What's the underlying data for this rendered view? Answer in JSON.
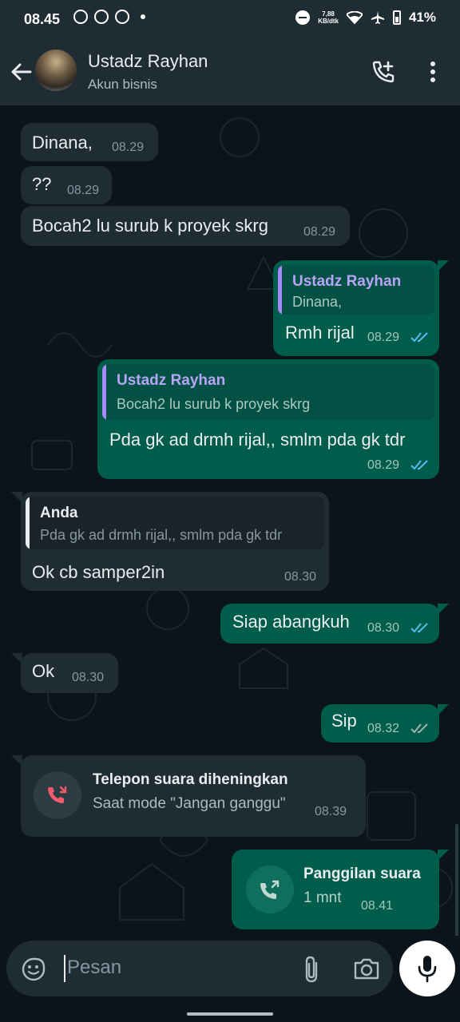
{
  "status_bar": {
    "time": "08.45",
    "net_speed_value": "7,88",
    "net_speed_unit": "KB/dtk",
    "battery": "41%"
  },
  "header": {
    "name": "Ustadz Rayhan",
    "subtitle": "Akun bisnis"
  },
  "messages": [
    {
      "dir": "in",
      "text": "Dinana,",
      "time": "08.29"
    },
    {
      "dir": "in",
      "text": "??",
      "time": "08.29"
    },
    {
      "dir": "in",
      "text": "Bocah2 lu surub k proyek skrg",
      "time": "08.29"
    },
    {
      "dir": "out",
      "quote_name": "Ustadz Rayhan",
      "quote_text": "Dinana,",
      "text": "Rmh rijal",
      "time": "08.29"
    },
    {
      "dir": "out",
      "quote_name": "Ustadz Rayhan",
      "quote_text": "Bocah2 lu surub k proyek skrg",
      "text": "Pda gk ad drmh rijal,, smlm pda gk tdr",
      "time": "08.29"
    },
    {
      "dir": "in",
      "quote_name": "Anda",
      "quote_text": "Pda gk ad drmh rijal,, smlm pda gk tdr",
      "text": "Ok cb samper2in",
      "time": "08.30"
    },
    {
      "dir": "out",
      "text": "Siap abangkuh",
      "time": "08.30"
    },
    {
      "dir": "in",
      "text": "Ok",
      "time": "08.30"
    },
    {
      "dir": "out",
      "text": "Sip",
      "time": "08.32"
    },
    {
      "dir": "in",
      "call_title": "Telepon suara diheningkan",
      "call_sub": "Saat mode \"Jangan ganggu\"",
      "time": "08.39"
    },
    {
      "dir": "out",
      "call_title": "Panggilan suara",
      "call_sub": "1 mnt",
      "time": "08.41"
    }
  ],
  "composer": {
    "placeholder": "Pesan"
  },
  "colors": {
    "outgoing_bubble": "#005c4b",
    "incoming_bubble": "#202c33",
    "read_tick": "#53bdeb",
    "quote_purple": "#a78bfa",
    "missed_call_red": "#f15c6d"
  }
}
